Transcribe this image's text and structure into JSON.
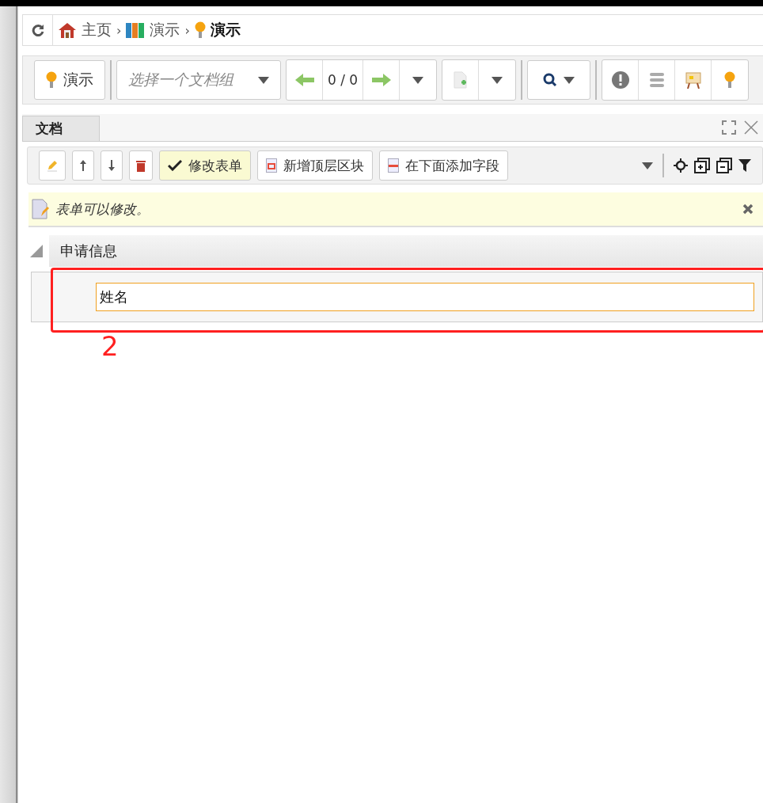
{
  "breadcrumb": [
    {
      "label": "主页",
      "kind": "home"
    },
    {
      "separator": "›",
      "label": "演示",
      "kind": "books"
    },
    {
      "separator": "›",
      "label": "演示",
      "kind": "bulb",
      "current": true
    }
  ],
  "toolbar": {
    "app_button": "演示",
    "group_select": {
      "placeholder": "选择一个文档组"
    },
    "pager": "0 / 0"
  },
  "tabs": [
    {
      "label": "文档",
      "selected": true
    }
  ],
  "edit_toolbar": {
    "buttons": [
      {
        "kind": "pencil",
        "selected": false
      },
      {
        "kind": "up",
        "selected": false
      },
      {
        "kind": "down",
        "selected": false
      },
      {
        "kind": "trash",
        "selected": false
      },
      {
        "kind": "check",
        "label": "修改表单",
        "selected": true
      },
      {
        "kind": "block",
        "label": "新增顶层区块",
        "selected": false
      },
      {
        "kind": "field",
        "label": "在下面添加字段",
        "selected": false
      }
    ]
  },
  "notice": "表单可以修改。",
  "section": {
    "title": "申请信息",
    "expanded": true,
    "fields": [
      {
        "value": "姓名"
      }
    ]
  },
  "annotation": "2"
}
